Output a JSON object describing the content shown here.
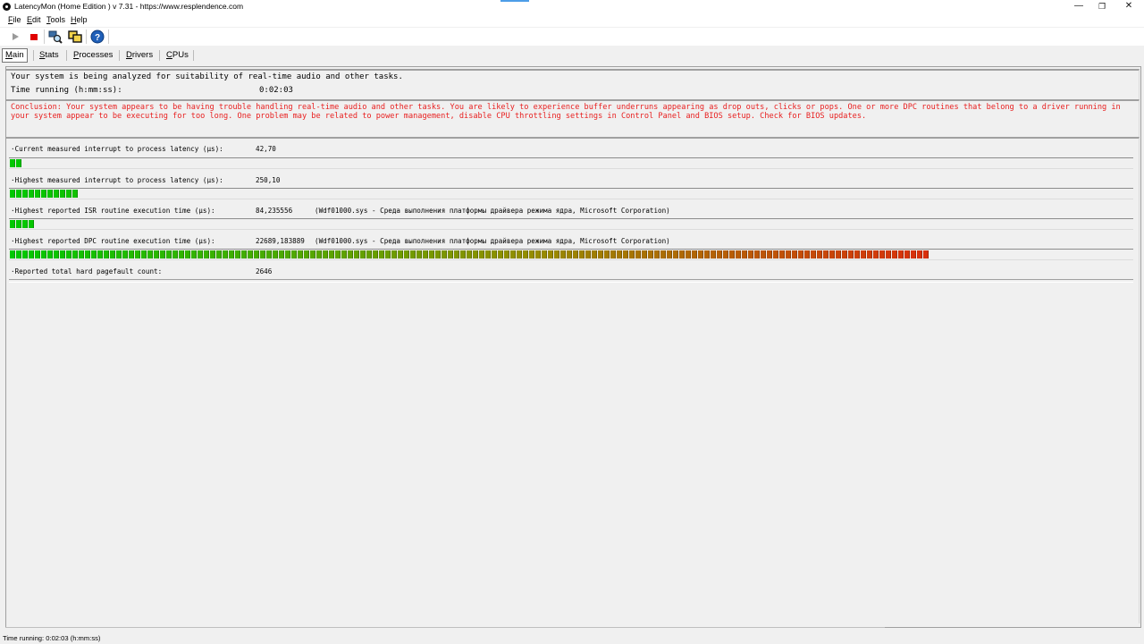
{
  "window": {
    "title": "LatencyMon  (Home Edition )  v 7.31 - https://www.resplendence.com",
    "minimize": "—",
    "restore": "❐",
    "close": "✕"
  },
  "menu": [
    {
      "label": "File",
      "ul": "F",
      "rest": "ile"
    },
    {
      "label": "Edit",
      "ul": "E",
      "rest": "dit"
    },
    {
      "label": "Tools",
      "ul": "T",
      "rest": "ools"
    },
    {
      "label": "Help",
      "ul": "H",
      "rest": "elp"
    }
  ],
  "toolbar": {
    "icons": [
      "play-icon",
      "stop-icon",
      "search-icon",
      "windows-icon",
      "help-icon"
    ],
    "stop_color": "#e00000",
    "help_color": "#1f5fb8"
  },
  "tabs": [
    {
      "label": "Main",
      "ul": "M",
      "rest": "ain",
      "active": true
    },
    {
      "label": "Stats",
      "ul": "S",
      "rest": "tats",
      "active": false
    },
    {
      "label": "Processes",
      "ul": "P",
      "rest": "rocesses",
      "active": false
    },
    {
      "label": "Drivers",
      "ul": "D",
      "rest": "rivers",
      "active": false
    },
    {
      "label": "CPUs",
      "ul": "C",
      "rest": "PUs",
      "active": false
    }
  ],
  "summary": {
    "analyzing": "Your system is being analyzed for suitability of real-time audio and other tasks.",
    "time_label": "Time running (h:mm:ss):",
    "time_value": "0:02:03"
  },
  "conclusion": "Conclusion: Your system appears to be having trouble handling real-time audio and other tasks. You are likely to experience buffer underruns appearing as drop outs, clicks or pops. One or more DPC routines that belong to a driver running in your system appear to be executing for too long. One problem may be related to power management, disable CPU throttling settings in Control Panel and BIOS setup. Check for BIOS updates.",
  "metrics": [
    {
      "label": "·Current measured interrupt to process latency (µs):",
      "value": "42,70",
      "info": "",
      "segments": 2
    },
    {
      "label": "·Highest measured interrupt to process latency (µs):",
      "value": "250,10",
      "info": "",
      "segments": 11
    },
    {
      "label": "·Highest reported ISR routine execution time (µs):",
      "value": "84,235556",
      "info": "(Wdf01000.sys - Среда выполнения платформы драйвера режима ядра, Microsoft Corporation)",
      "segments": 4
    },
    {
      "label": "·Highest reported DPC routine execution time (µs):",
      "value": "22689,183889",
      "info": "(Wdf01000.sys - Среда выполнения платформы драйвера режима ядра, Microsoft Corporation)",
      "segments": 147
    },
    {
      "label": "·Reported total hard pagefault count:",
      "value": "2646",
      "info": "",
      "segments": 0
    }
  ],
  "colors": {
    "bar_green": "#00c800",
    "bar_red": "#f01010",
    "conclusion_text": "#e82020"
  },
  "statusbar": {
    "text": "Time running: 0:02:03  (h:mm:ss)"
  }
}
